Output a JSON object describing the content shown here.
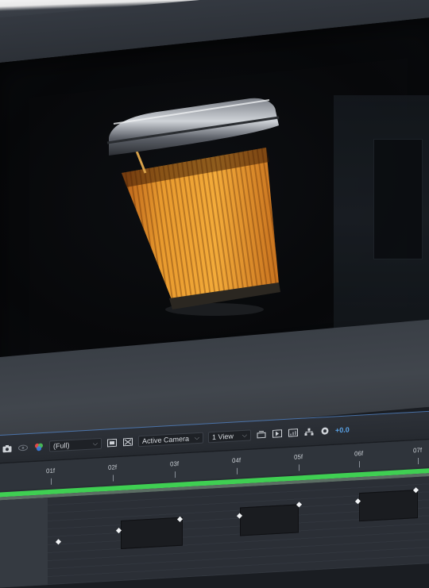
{
  "viewer_toolbar": {
    "snapshot_icon": "camera-icon",
    "show_snapshot_icon": "eye-icon",
    "channel_icon": "rgb-channel-icon",
    "resolution": "(Full)",
    "region_icon": "region-of-interest-icon",
    "transparency_grid_icon": "transparency-grid-icon",
    "camera": "Active Camera",
    "view_layout": "1 View",
    "toggle_pixel_aspect_icon": "pixel-aspect-icon",
    "fast_preview_icon": "fast-preview-icon",
    "timeline_icon": "timeline-icon",
    "flowchart_icon": "flowchart-icon",
    "reset_exposure_icon": "exposure-icon",
    "exposure_value": "+0.0"
  },
  "timeline": {
    "ticks": [
      "01f",
      "02f",
      "03f",
      "04f",
      "05f",
      "06f",
      "07f"
    ]
  },
  "colors": {
    "accent": "#4a72a8",
    "work_area": "#3fcf52",
    "exposure_text": "#5aa3e8",
    "cup_sleeve": "#e89a2e"
  }
}
